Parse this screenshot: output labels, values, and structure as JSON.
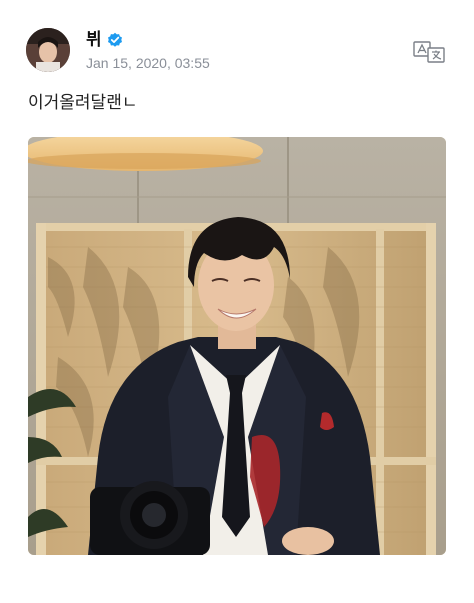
{
  "author": {
    "name": "뷔",
    "verified": true,
    "avatar_icon": "profile-avatar"
  },
  "post": {
    "timestamp": "Jan 15, 2020, 03:55",
    "text": "이거올려달랜ㄴ",
    "image_description_icon": "attached-photo"
  },
  "actions": {
    "translate_icon": "translate-icon"
  },
  "colors": {
    "verified_blue": "#1d9bf0",
    "timestamp_gray": "#8a8f98",
    "text": "#222222"
  }
}
